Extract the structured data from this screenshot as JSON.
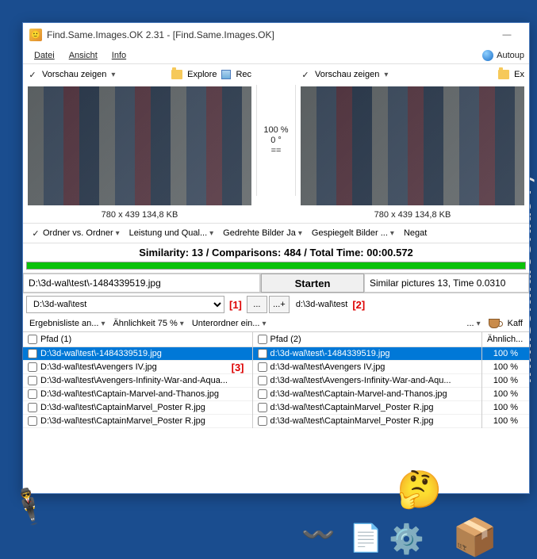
{
  "window": {
    "title": "Find.Same.Images.OK 2.31 - [Find.Same.Images.OK]",
    "minimize": "—"
  },
  "menu": {
    "datei": "Datei",
    "ansicht": "Ansicht",
    "info": "Info",
    "autoup": "Autoup"
  },
  "preview": {
    "show_label": "Vorschau zeigen",
    "explore": "Explore",
    "rec": "Rec",
    "ex": "Ex",
    "meta": "780 x 439 134,8 KB",
    "compare": {
      "pct": "100 %",
      "rotation": "0 °",
      "eq": "=="
    }
  },
  "options": {
    "folder_vs": "Ordner vs. Ordner",
    "perf": "Leistung und Qual...",
    "rot": "Gedrehte Bilder Ja",
    "mirror": "Gespiegelt Bilder ...",
    "negat": "Negat"
  },
  "status": "Similarity: 13 / Comparisons: 484 / Total Time: 00:00.572",
  "paths": {
    "left_file": "D:\\3d-wal\\test\\-1484339519.jpg",
    "start": "Starten",
    "right_status": "Similar pictures 13, Time 0.0310",
    "left_folder": "D:\\3d-wal\\test",
    "right_folder": "d:\\3d-wal\\test",
    "dots": "...",
    "dotsplus": "...+"
  },
  "annotations": {
    "a1": "[1]",
    "a2": "[2]",
    "a3": "[3]"
  },
  "filters": {
    "results": "Ergebnisliste an...",
    "similarity": "Ähnlichkeit 75 %",
    "subfolder": "Unterordner ein...",
    "more": "...",
    "kaff": "Kaff"
  },
  "columns": {
    "p1": "Pfad (1)",
    "p2": "Pfad (2)",
    "sim": "Ähnlich..."
  },
  "rows_left": [
    "D:\\3d-wal\\test\\-1484339519.jpg",
    "D:\\3d-wal\\test\\Avengers IV.jpg",
    "D:\\3d-wal\\test\\Avengers-Infinity-War-and-Aqua...",
    "D:\\3d-wal\\test\\Captain-Marvel-and-Thanos.jpg",
    "D:\\3d-wal\\test\\CaptainMarvel_Poster R.jpg",
    "D:\\3d-wal\\test\\CaptainMarvel_Poster R.jpg"
  ],
  "rows_right": [
    "d:\\3d-wal\\test\\-1484339519.jpg",
    "d:\\3d-wal\\test\\Avengers IV.jpg",
    "d:\\3d-wal\\test\\Avengers-Infinity-War-and-Aqu...",
    "d:\\3d-wal\\test\\Captain-Marvel-and-Thanos.jpg",
    "d:\\3d-wal\\test\\CaptainMarvel_Poster R.jpg",
    "d:\\3d-wal\\test\\CaptainMarvel_Poster R.jpg"
  ],
  "rows_sim": [
    "100 %",
    "100 %",
    "100 %",
    "100 %",
    "100 %",
    "100 %"
  ],
  "watermark": "www.SoftwareOK.de :-)"
}
